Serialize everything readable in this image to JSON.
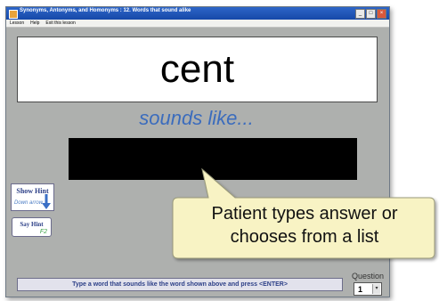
{
  "window": {
    "title": "Synonyms, Antonyms, and Homonyms : 12. Words that sound alike",
    "buttons": {
      "minimize": "_",
      "maximize": "□",
      "close": "×"
    }
  },
  "menu": [
    "Lesson",
    "Help",
    "Exit this lesson"
  ],
  "word": "cent",
  "prompt": "sounds like...",
  "answer": {
    "value": ""
  },
  "show_hint": {
    "label": "Show Hint",
    "sub": "Down arrow"
  },
  "say_hint": {
    "label": "Say Hint",
    "key": "F2"
  },
  "instruction": "Type a word that sounds like the word shown above and press <ENTER>",
  "question": {
    "label": "Question",
    "value": "1",
    "dropdown_glyph": "▾"
  },
  "callout": {
    "line1": "Patient types answer or",
    "line2": "chooses from a list"
  },
  "colors": {
    "titlebar": "#1f56b8",
    "prompt": "#3b6cbd",
    "callout_fill": "#f8f3c4",
    "background": "#aeb0ae"
  }
}
